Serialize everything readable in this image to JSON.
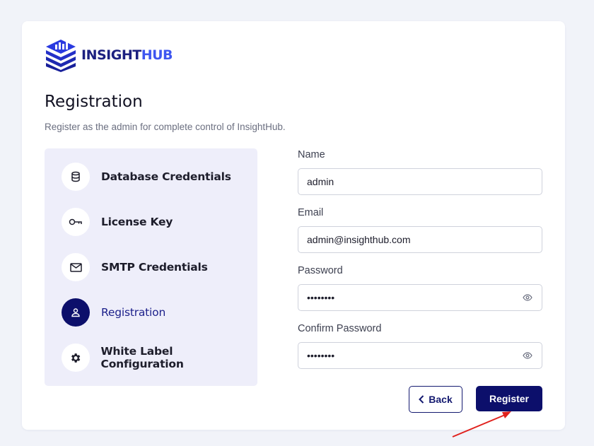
{
  "brand": {
    "part1": "INSIGHT",
    "part2": "HUB"
  },
  "header": {
    "title": "Registration",
    "subtitle": "Register as the admin for complete control of InsightHub."
  },
  "steps": [
    {
      "label": "Database Credentials",
      "icon": "database-icon",
      "active": false
    },
    {
      "label": "License Key",
      "icon": "key-icon",
      "active": false
    },
    {
      "label": "SMTP Credentials",
      "icon": "mail-icon",
      "active": false
    },
    {
      "label": "Registration",
      "icon": "user-icon",
      "active": true
    },
    {
      "label": "White Label Configuration",
      "icon": "gear-icon",
      "active": false
    }
  ],
  "form": {
    "name": {
      "label": "Name",
      "value": "admin"
    },
    "email": {
      "label": "Email",
      "value": "admin@insighthub.com"
    },
    "password": {
      "label": "Password",
      "value": "••••••••"
    },
    "confirm_password": {
      "label": "Confirm Password",
      "value": "••••••••"
    }
  },
  "buttons": {
    "back": "Back",
    "register": "Register"
  },
  "colors": {
    "primary": "#0c0f6b",
    "accent": "#3e56f0",
    "panel": "#eeeefa",
    "annotation": "#e0211d"
  }
}
